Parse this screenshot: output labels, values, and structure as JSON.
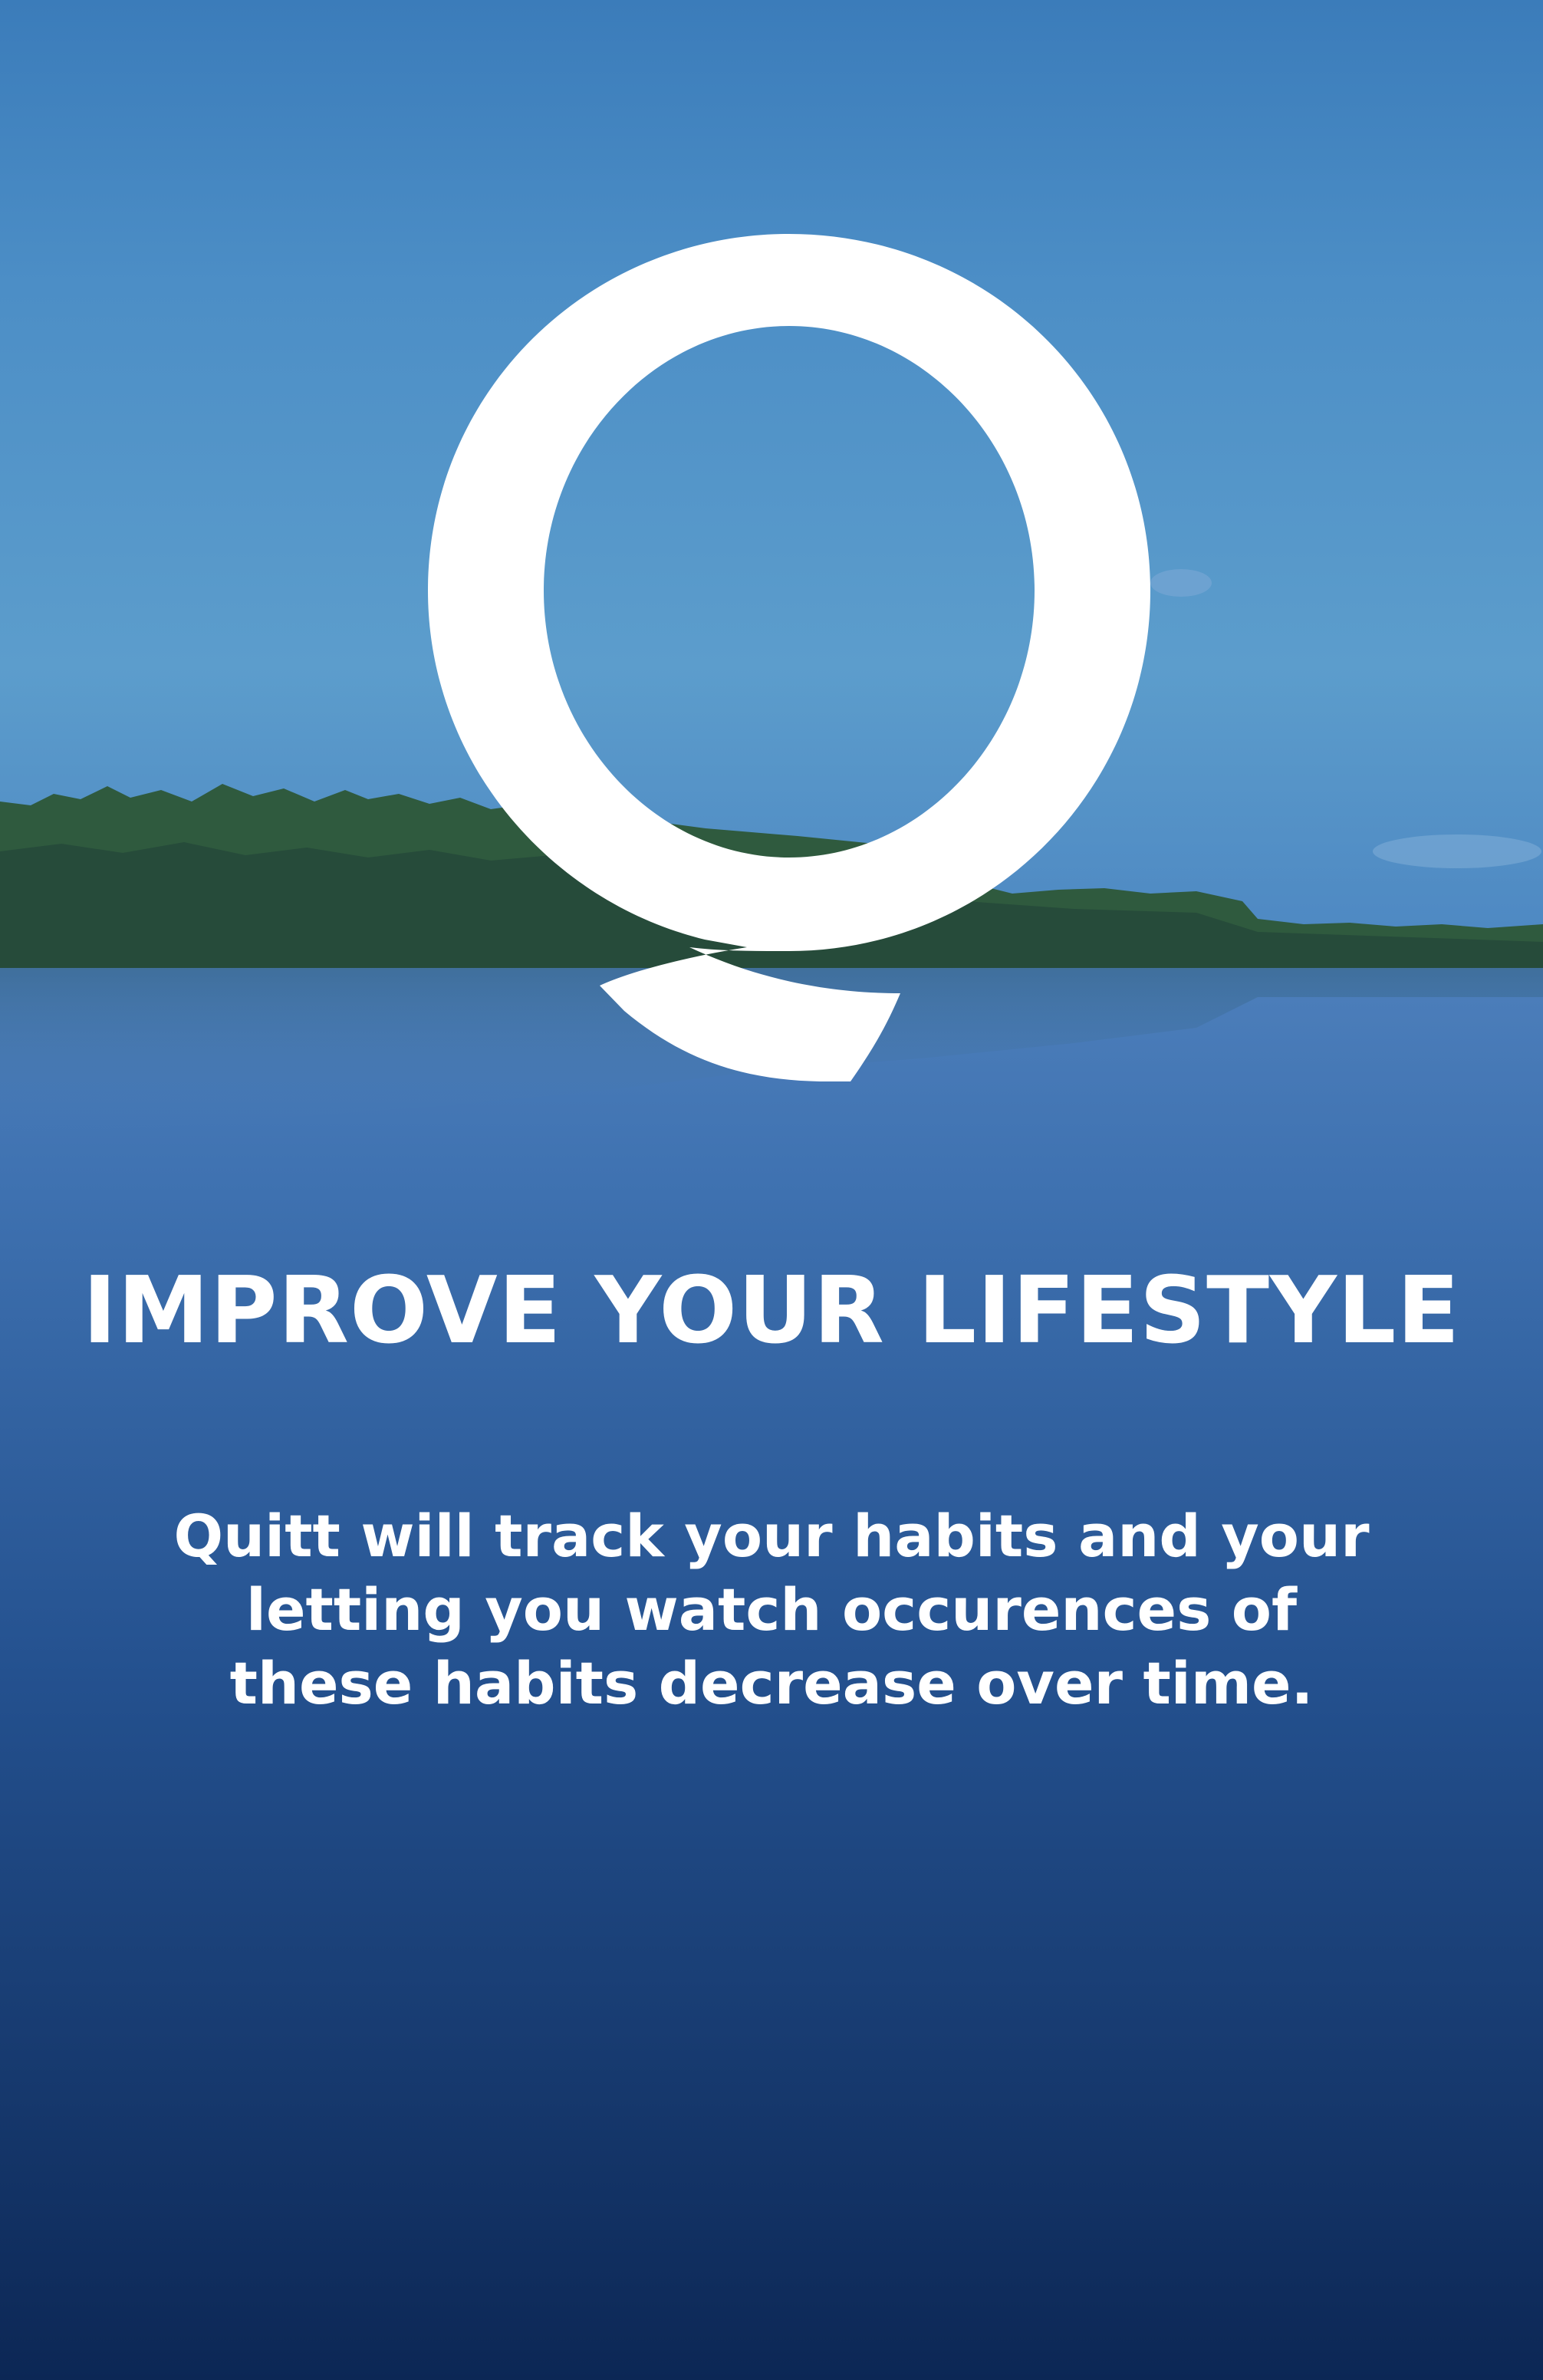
{
  "onboarding": {
    "logo_letter": "Q",
    "headline": "IMPROVE YOUR LIFESTYLE",
    "description_lines": [
      "Quitt will track your habits and your",
      "letting you watch occurences of",
      "these habits decrease over time."
    ]
  },
  "colors": {
    "sky_top": "#3b7cba",
    "water_deep": "#0d2a58",
    "text": "#ffffff"
  },
  "icons": [
    "quitt-q-logo-icon"
  ]
}
